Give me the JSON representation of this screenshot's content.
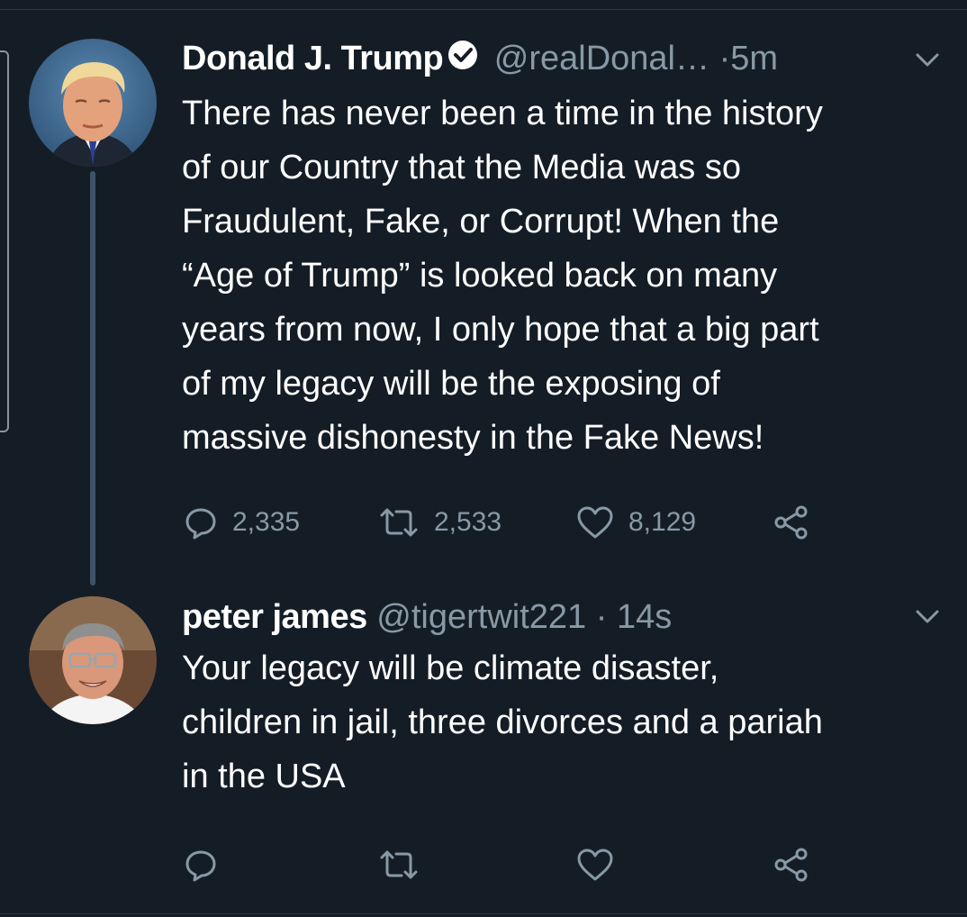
{
  "colors": {
    "background": "#141d26",
    "text": "#ffffff",
    "muted": "#8899a6",
    "thread_line": "#3d5466"
  },
  "tweets": [
    {
      "display_name": "Donald J. Trump",
      "verified": true,
      "handle": "@realDonal…",
      "separator": "·",
      "time": "5m",
      "text": "There has never been a time in the history of our Country that the Media was so Fraudulent, Fake, or Corrupt! When the “Age of Trump” is looked back on many years from now, I only hope that a big part of my legacy will be the exposing of massive dishonesty in the Fake News!",
      "text_lines": [
        "There has never been a time in the history",
        "of our Country that the Media was so",
        "Fraudulent, Fake, or Corrupt! When the",
        "“Age of Trump” is looked back on many",
        "years from now, I only hope that a big part",
        "of my legacy will be the exposing of",
        "massive dishonesty in the Fake News!"
      ],
      "replies": "2,335",
      "retweets": "2,533",
      "likes": "8,129",
      "icons": [
        "reply-icon",
        "retweet-icon",
        "like-icon",
        "share-icon",
        "chevron-down-icon",
        "verified-badge-icon"
      ]
    },
    {
      "display_name": "peter james",
      "verified": false,
      "handle": "@tigertwit221",
      "separator": "·",
      "time": "14s",
      "text": "Your legacy will be climate disaster, children in jail, three divorces and a pariah in the USA",
      "text_lines": [
        "Your legacy will be climate disaster,",
        "children in jail, three divorces and a pariah",
        "in the USA"
      ],
      "replies": "",
      "retweets": "",
      "likes": "",
      "icons": [
        "reply-icon",
        "retweet-icon",
        "like-icon",
        "share-icon",
        "chevron-down-icon"
      ]
    }
  ]
}
